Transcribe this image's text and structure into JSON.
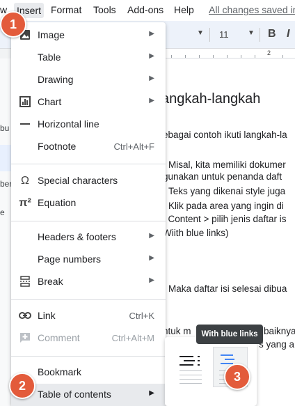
{
  "menubar": {
    "items": [
      "w",
      "Insert",
      "Format",
      "Tools",
      "Add-ons",
      "Help"
    ],
    "saved_status": "All changes saved in"
  },
  "toolbar": {
    "font_size": "11",
    "bold_label": "B",
    "italic_label": "I"
  },
  "ruler": {
    "label": "2"
  },
  "left_strip": {
    "fragments": [
      "bu",
      "ber",
      "e"
    ]
  },
  "document": {
    "lines": [
      "angkah-langkah",
      "ebagai contoh ikuti langkah-la",
      "Misal, kita memiliki dokumer",
      "gunakan untuk penanda daft",
      "Teks yang dikenai style juga",
      "Klik pada area yang ingin di",
      "f Content > pilih jenis daftar is",
      "Wiith blue links)",
      "Maka daftar isi selesai dibua",
      "ntuk m",
      "baiknya",
      "s yang a"
    ]
  },
  "insert_menu": {
    "items": [
      {
        "label": "Image",
        "icon": "image-icon",
        "submenu": true
      },
      {
        "label": "Table",
        "submenu": true
      },
      {
        "label": "Drawing",
        "submenu": true
      },
      {
        "label": "Chart",
        "icon": "chart-icon",
        "submenu": true
      },
      {
        "label": "Horizontal line",
        "icon": "horizontal-line-icon"
      },
      {
        "label": "Footnote",
        "shortcut": "Ctrl+Alt+F"
      },
      {
        "label": "Special characters",
        "icon": "omega-icon"
      },
      {
        "label": "Equation",
        "icon": "pi-icon"
      },
      {
        "label": "Headers & footers",
        "submenu": true
      },
      {
        "label": "Page numbers",
        "submenu": true
      },
      {
        "label": "Break",
        "icon": "break-icon",
        "submenu": true
      },
      {
        "label": "Link",
        "icon": "link-icon",
        "shortcut": "Ctrl+K"
      },
      {
        "label": "Comment",
        "icon": "comment-icon",
        "shortcut": "Ctrl+Alt+M",
        "disabled": true
      },
      {
        "label": "Bookmark"
      },
      {
        "label": "Table of contents",
        "submenu": true,
        "highlighted": true
      }
    ]
  },
  "toc_submenu": {
    "tooltip": "With blue links",
    "options": [
      "With page numbers",
      "With blue links"
    ],
    "link_color": "#4285f4"
  },
  "callouts": [
    "1",
    "2",
    "3"
  ],
  "colors": {
    "callout": "#e35b3b",
    "menu_hover": "#e8eaed",
    "accent": "#1a73e8"
  }
}
